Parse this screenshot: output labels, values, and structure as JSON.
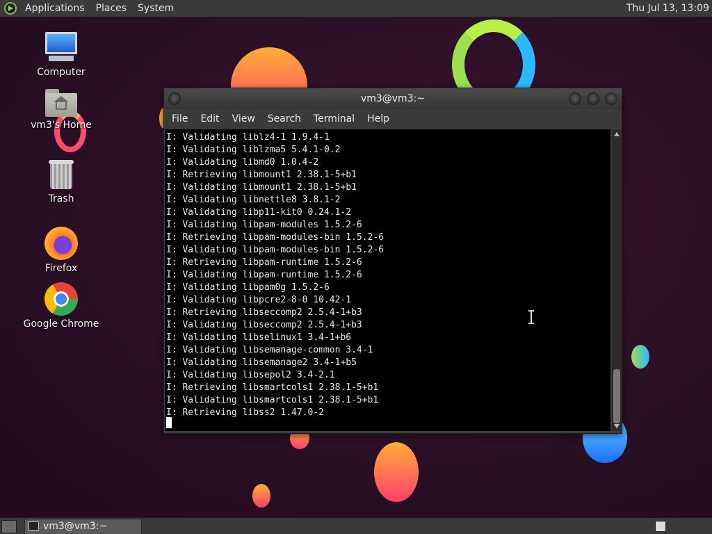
{
  "top_panel": {
    "menus": [
      "Applications",
      "Places",
      "System"
    ],
    "clock": "Thu Jul 13, 13:09"
  },
  "desktop": {
    "icons": [
      {
        "label": "Computer",
        "icon": "computer-icon"
      },
      {
        "label": "vm3's Home",
        "icon": "home-folder-icon"
      },
      {
        "label": "Trash",
        "icon": "trash-icon"
      },
      {
        "label": "Firefox",
        "icon": "firefox-icon"
      },
      {
        "label": "Google Chrome",
        "icon": "chrome-icon"
      }
    ]
  },
  "terminal": {
    "title": "vm3@vm3:~",
    "menu": [
      "File",
      "Edit",
      "View",
      "Search",
      "Terminal",
      "Help"
    ],
    "lines": [
      "I: Validating liblz4-1 1.9.4-1",
      "I: Validating liblzma5 5.4.1-0.2",
      "I: Validating libmd0 1.0.4-2",
      "I: Retrieving libmount1 2.38.1-5+b1",
      "I: Validating libmount1 2.38.1-5+b1",
      "I: Validating libnettle8 3.8.1-2",
      "I: Validating libp11-kit0 0.24.1-2",
      "I: Validating libpam-modules 1.5.2-6",
      "I: Retrieving libpam-modules-bin 1.5.2-6",
      "I: Validating libpam-modules-bin 1.5.2-6",
      "I: Retrieving libpam-runtime 1.5.2-6",
      "I: Validating libpam-runtime 1.5.2-6",
      "I: Validating libpam0g 1.5.2-6",
      "I: Validating libpcre2-8-0 10.42-1",
      "I: Retrieving libseccomp2 2.5.4-1+b3",
      "I: Validating libseccomp2 2.5.4-1+b3",
      "I: Validating libselinux1 3.4-1+b6",
      "I: Validating libsemanage-common 3.4-1",
      "I: Validating libsemanage2 3.4-1+b5",
      "I: Validating libsepol2 3.4-2.1",
      "I: Retrieving libsmartcols1 2.38.1-5+b1",
      "I: Validating libsmartcols1 2.38.1-5+b1",
      "I: Retrieving libss2 1.47.0-2"
    ]
  },
  "taskbar": {
    "task_label": "vm3@vm3:~"
  }
}
